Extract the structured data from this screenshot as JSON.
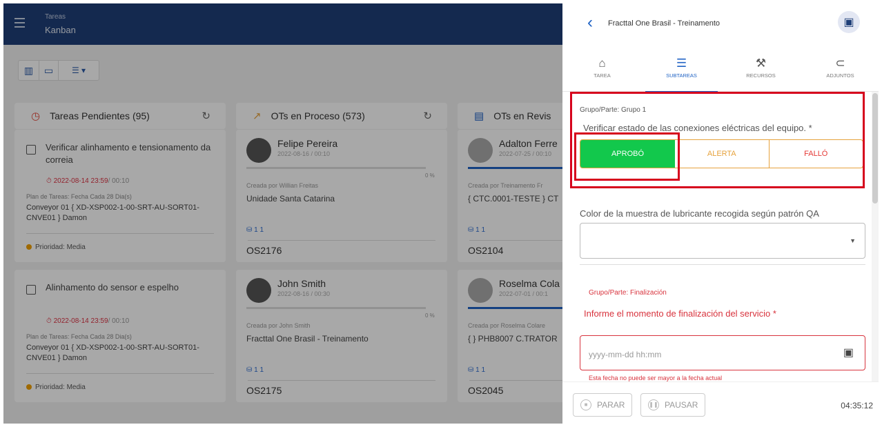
{
  "header": {
    "module": "Tareas",
    "view": "Kanban"
  },
  "columns": [
    {
      "title": "Tareas Pendientes (95)"
    },
    {
      "title": "OTs en Proceso (573)"
    },
    {
      "title": "OTs en Revis"
    }
  ],
  "pending_cards": [
    {
      "title": "Verificar alinhamento e tensionamento da correia",
      "due": "2022-08-14 23:59",
      "duration": "/ 00:10",
      "plan": "Plan de Tareas: Fecha Cada 28 Dia(s)",
      "equipment": "Conveyor 01 { XD-XSP002-1-00-SRT-AU-SORT01-CNVE01 } Damon",
      "priority": "Prioridad: Media"
    },
    {
      "title": "Alinhamento do sensor e espelho",
      "due": "2022-08-14 23:59",
      "duration": "/ 00:10",
      "plan": "Plan de Tareas: Fecha Cada 28 Dia(s)",
      "equipment": "Conveyor 01 { XD-XSP002-1-00-SRT-AU-SORT01-CNVE01 } Damon",
      "priority": "Prioridad: Media"
    }
  ],
  "process_cards": [
    {
      "name": "Felipe Pereira",
      "date": "2022-08-16 / 00:10",
      "progress": "0 %",
      "created_by": "Creada por Willian Freitas",
      "unit": "Unidade Santa Catarina",
      "counts": "1   1",
      "os": "OS2176"
    },
    {
      "name": "John Smith",
      "date": "2022-08-16 / 00:30",
      "progress": "0 %",
      "created_by": "Creada por John Smith",
      "unit": "Fracttal One Brasil - Treinamento",
      "counts": "1   1",
      "os": "OS2175"
    }
  ],
  "review_cards": [
    {
      "name": "Adalton Ferre",
      "date": "2022-07-25 / 00:10",
      "created_by": "Creada por Treinamento Fr",
      "unit": "{ CTC.0001-TESTE } CT",
      "counts": "1   1",
      "os": "OS2104"
    },
    {
      "name": "Roselma Cola",
      "date": "2022-07-01 / 00:1",
      "created_by": "Creada por Roselma Colare",
      "unit": "{ } PHB8007 C.TRATOR",
      "counts": "1   1",
      "os": "OS2045"
    }
  ],
  "panel": {
    "title": "Fracttal One Brasil - Treinamento",
    "tabs": [
      {
        "label": "TAREA"
      },
      {
        "label": "SUBTAREAS"
      },
      {
        "label": "RECURSOS"
      },
      {
        "label": "ADJUNTOS"
      }
    ],
    "group1": "Grupo/Parte: Grupo 1",
    "question1": "Verificar estado de las conexiones eléctricas del equipo. *",
    "options": {
      "approve": "APROBÓ",
      "alert": "ALERTA",
      "fail": "FALLÓ"
    },
    "question2": "Color de la muestra de lubricante recogida según patrón QA",
    "group2": "Grupo/Parte: Finalización",
    "question3": "Informe el momento de finalización del servicio *",
    "datetime_placeholder": "yyyy-mm-dd hh:mm",
    "error": "Esta fecha no puede ser mayor a la fecha actual",
    "stop": "PARAR",
    "pause": "PAUSAR",
    "timer": "04:35:12"
  },
  "colors": {
    "brand": "#1f3f78",
    "accent": "#1f62c4",
    "success": "#12c84c",
    "warning": "#e6a23c",
    "error": "#d8333d"
  }
}
